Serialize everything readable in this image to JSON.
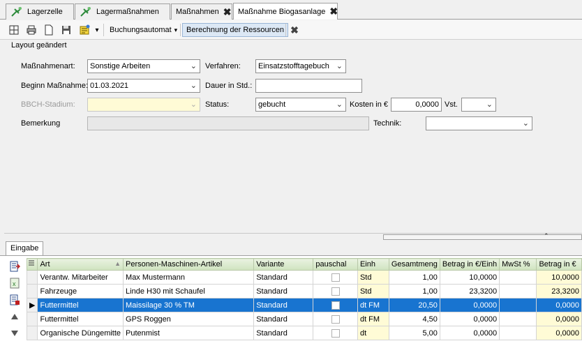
{
  "tabs": [
    {
      "label": "Lagerzelle",
      "icon": "tool-icon"
    },
    {
      "label": "Lagermaßnahmen",
      "icon": "tool-icon"
    },
    {
      "label": "Maßnahmen",
      "close": "✖"
    },
    {
      "label": "Maßnahme Biogasanlage",
      "close": "✖"
    }
  ],
  "toolbar": {
    "buchungsautomat": "Buchungsautomat",
    "berechnung": "Berechnung der Ressourcen",
    "dropdown_arrow": "▾",
    "close": "✖"
  },
  "form": {
    "section_title": "Layout geändert",
    "massnahmenart_label": "Maßnahmenart:",
    "massnahmenart_value": "Sonstige Arbeiten",
    "verfahren_label": "Verfahren:",
    "verfahren_value": "Einsatzstofftagebuch",
    "beginn_label": "Beginn Maßnahme:",
    "beginn_value": "01.03.2021",
    "dauer_label": "Dauer in Std.:",
    "dauer_value": "",
    "bbch_label": "BBCH-Stadium:",
    "bbch_value": "",
    "status_label": "Status:",
    "status_value": "gebucht",
    "kosten_label": "Kosten in €",
    "kosten_value": "0,0000",
    "vst_label": "Vst.",
    "vst_value": "",
    "bemerkung_label": "Bemerkung",
    "bemerkung_value": "",
    "technik_label": "Technik:",
    "technik_value": ""
  },
  "bottom_tab": "Eingabe",
  "grid": {
    "headers": [
      "Art",
      "Personen-Maschinen-Artikel",
      "Variante",
      "pauschal",
      "Einh",
      "Gesamtmeng",
      "Betrag in €/Einh",
      "MwSt %",
      "Betrag in €"
    ],
    "rows": [
      {
        "art": "Verantw. Mitarbeiter",
        "artikel": "Max Mustermann",
        "variante": "Standard",
        "einh": "Std",
        "menge": "1,00",
        "betrag_einh": "10,0000",
        "mwst": "",
        "betrag": "10,0000"
      },
      {
        "art": "Fahrzeuge",
        "artikel": "Linde H30 mit Schaufel",
        "variante": "Standard",
        "einh": "Std",
        "menge": "1,00",
        "betrag_einh": "23,3200",
        "mwst": "",
        "betrag": "23,3200"
      },
      {
        "art": "Futtermittel",
        "artikel": "Maissilage 30 % TM",
        "variante": "Standard",
        "einh": "dt FM",
        "menge": "20,50",
        "betrag_einh": "0,0000",
        "mwst": "",
        "betrag": "0,0000"
      },
      {
        "art": "Futtermittel",
        "artikel": "GPS Roggen",
        "variante": "Standard",
        "einh": "dt FM",
        "menge": "4,50",
        "betrag_einh": "0,0000",
        "mwst": "",
        "betrag": "0,0000"
      },
      {
        "art": "Organische Düngemitte",
        "artikel": "Putenmist",
        "variante": "Standard",
        "einh": "dt",
        "menge": "5,00",
        "betrag_einh": "0,0000",
        "mwst": "",
        "betrag": "0,0000"
      }
    ],
    "selected_row": 2
  },
  "colors": {
    "selection": "#1874d0",
    "highlight": "#fffbd6",
    "header": "#cfe3bf"
  }
}
